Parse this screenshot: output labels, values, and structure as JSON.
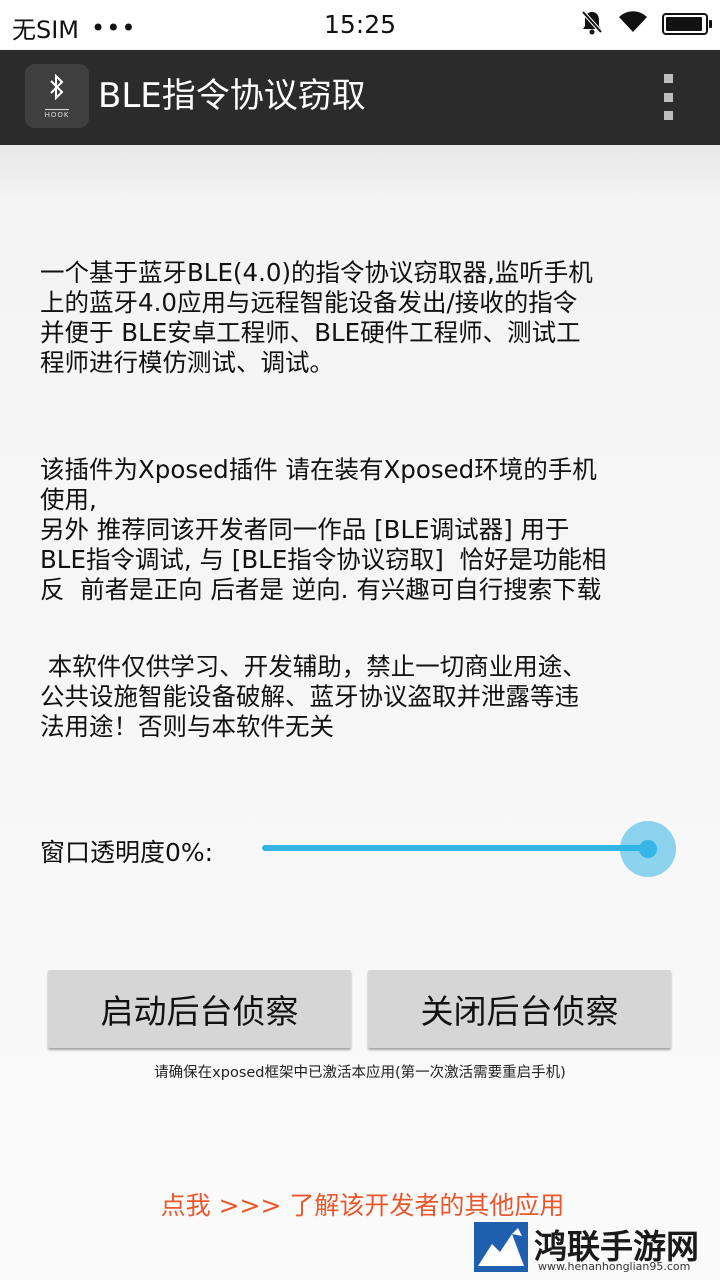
{
  "status_bar": {
    "carrier": "无SIM",
    "dots": "•••",
    "time": "15:25",
    "battery_level": 0.95
  },
  "app_bar": {
    "title": "BLE指令协议窃取",
    "icon_label": "HOOK"
  },
  "content": {
    "paragraph_1": "一个基于蓝牙BLE(4.0)的指令协议窃取器,监听手机\n上的蓝牙4.0应用与远程智能设备发出/接收的指令\n并便于 BLE安卓工程师、BLE硬件工程师、测试工\n程师进行模仿测试、调试。",
    "paragraph_2": "该插件为Xposed插件 请在装有Xposed环境的手机\n使用,\n另外 推荐同该开发者同一作品 [BLE调试器] 用于\nBLE指令调试, 与 [BLE指令协议窃取]  恰好是功能相\n反  前者是正向 后者是 逆向. 有兴趣可自行搜索下载",
    "paragraph_3": " 本软件仅供学习、开发辅助，禁止一切商业用途、\n公共设施智能设备破解、蓝牙协议盗取并泄露等违\n法用途！否则与本软件无关",
    "opacity_label": "窗口透明度0%:",
    "opacity_slider_value": 1.0,
    "start_button": "启动后台侦察",
    "stop_button": "关闭后台侦察",
    "hint": "请确保在xposed框架中已激活本应用(第一次激活需要重启手机)",
    "developer_link": "点我 >>> 了解该开发者的其他应用"
  },
  "watermark": {
    "brand": "鸿联手游网",
    "url": "www.henanhonglian95.com"
  },
  "colors": {
    "accent": "#33b5e5",
    "link": "#e8582c",
    "app_bar": "#2b2b2b"
  }
}
